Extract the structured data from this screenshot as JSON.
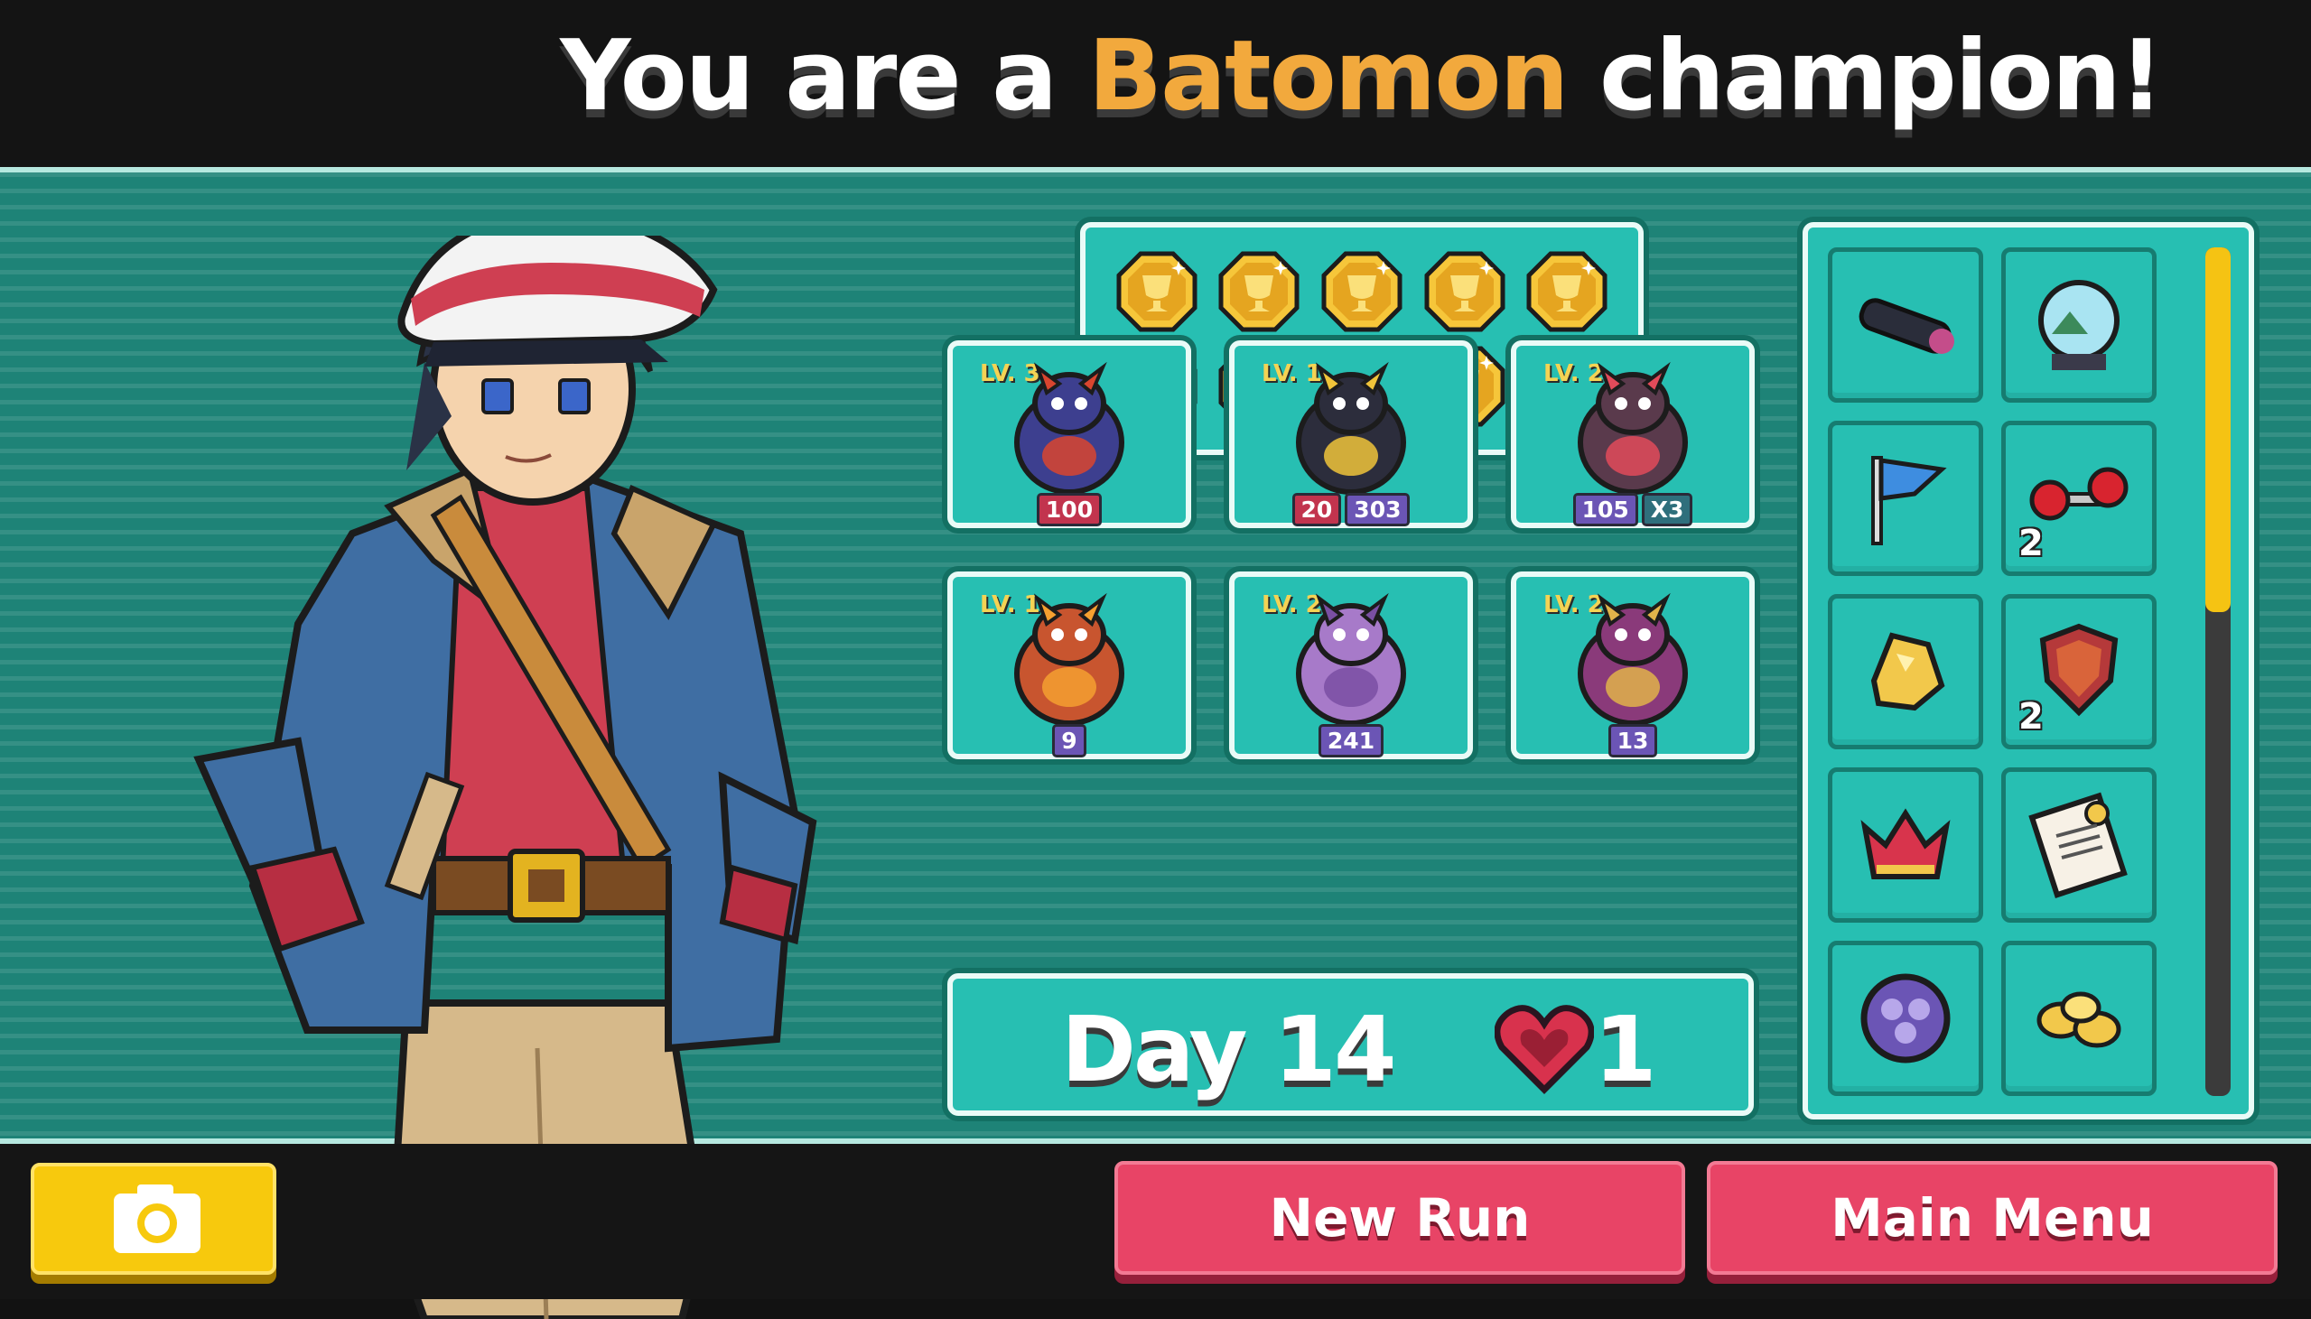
{
  "header": {
    "title_before": "You are a",
    "title_highlight": "Batomon",
    "title_after": "champion!"
  },
  "trophies": {
    "count": 10,
    "icon": "trophy-medal-icon"
  },
  "team": [
    {
      "level": "LV. 3",
      "name_icon": "dragon-monster-icon",
      "stats": [
        "100"
      ]
    },
    {
      "level": "LV. 1",
      "name_icon": "cobra-monster-icon",
      "stats": [
        "20",
        "303"
      ]
    },
    {
      "level": "LV. 2",
      "name_icon": "bat-monster-icon",
      "stats": [
        "105",
        "X3"
      ]
    },
    {
      "level": "LV. 1",
      "name_icon": "mushroom-monster-icon",
      "stats": [
        "9"
      ]
    },
    {
      "level": "LV. 2",
      "name_icon": "ghost-blob-monster-icon",
      "stats": [
        "241"
      ]
    },
    {
      "level": "LV. 2",
      "name_icon": "serpent-monster-icon",
      "stats": [
        "13"
      ]
    }
  ],
  "status": {
    "day": "Day 14",
    "lives": "1"
  },
  "items": [
    {
      "icon": "telescope-icon",
      "qty": ""
    },
    {
      "icon": "snow-globe-icon",
      "qty": ""
    },
    {
      "icon": "blue-flag-icon",
      "qty": ""
    },
    {
      "icon": "dumbbell-icon",
      "qty": "2"
    },
    {
      "icon": "gold-nugget-icon",
      "qty": ""
    },
    {
      "icon": "shield-emblem-icon",
      "qty": "2"
    },
    {
      "icon": "crown-icon",
      "qty": ""
    },
    {
      "icon": "notepad-icon",
      "qty": ""
    },
    {
      "icon": "purple-orb-icon",
      "qty": ""
    },
    {
      "icon": "gold-coins-icon",
      "qty": ""
    }
  ],
  "scrollbar": {
    "position_fraction": 0.0,
    "visible_fraction": 0.43
  },
  "buttons": {
    "new_run": "New Run",
    "main_menu": "Main Menu",
    "screenshot": "camera-icon"
  },
  "colors": {
    "accent": "#f2a93d",
    "panel": "#27bfb2",
    "button": "#e84466",
    "camera": "#f7c90d"
  }
}
